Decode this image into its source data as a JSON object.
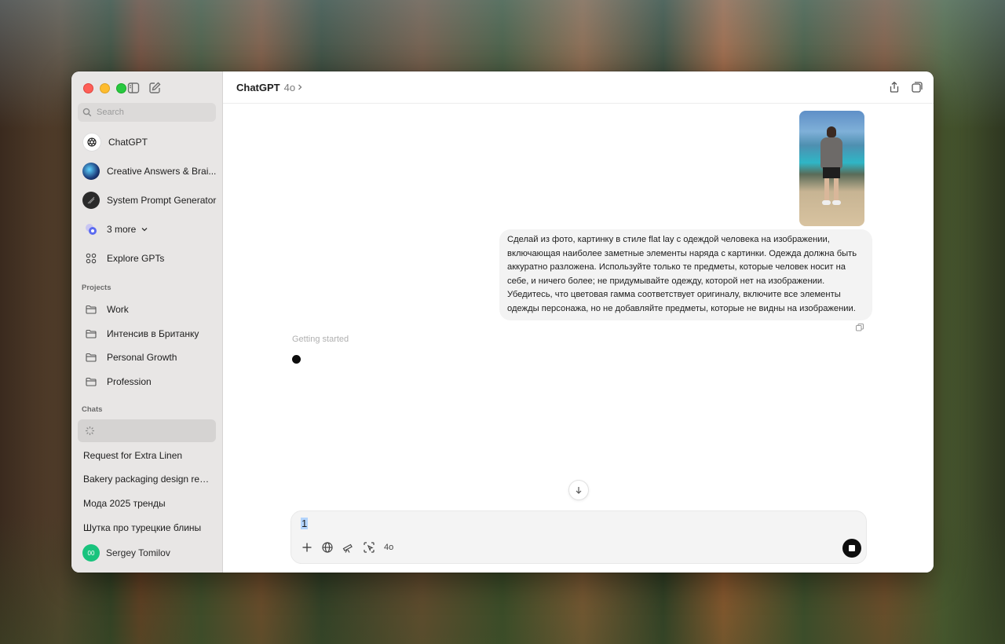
{
  "sidebar": {
    "search_placeholder": "Search",
    "gpts": [
      {
        "label": "ChatGPT",
        "icon": "openai-logo-icon"
      },
      {
        "label": "Creative Answers & Brai...",
        "icon": "gpt-avatar-icon"
      },
      {
        "label": "System Prompt Generator",
        "icon": "gpt-avatar-icon"
      },
      {
        "label": "3 more",
        "icon": "more-gpts-icon"
      },
      {
        "label": "Explore GPTs",
        "icon": "grid-icon"
      }
    ],
    "projects_title": "Projects",
    "projects": [
      "Work",
      "Интенсив в Британку",
      "Personal Growth",
      "Profession"
    ],
    "chats_title": "Chats",
    "chats": [
      "Request for Extra Linen",
      "Bakery packaging design requ...",
      "Мода 2025 тренды",
      "Шутка про турецкие блины"
    ],
    "user": {
      "initials": "00",
      "name": "Sergey Tomilov"
    }
  },
  "header": {
    "title": "ChatGPT",
    "model": "4o"
  },
  "conversation": {
    "user_message": "Сделай из фото, картинку в стиле flat lay с одеждой человека на изображении, включающая наиболее заметные элементы наряда с картинки. Одежда должна быть аккуратно разложена. Используйте только те предметы, которые человек носит на себе, и ничего более; не придумывайте одежду, которой нет на изображении. Убедитесь, что цветовая гамма соответствует оригиналу, включите все элементы одежды персонажа, но не добавляйте предметы, которые не видны на изображении.",
    "status": "Getting started"
  },
  "composer": {
    "input_value": "1",
    "model_label": "4o"
  },
  "colors": {
    "accent": "#0d0d0d",
    "user_avatar": "#19c37d",
    "sidebar_bg": "#e8e6e5"
  }
}
